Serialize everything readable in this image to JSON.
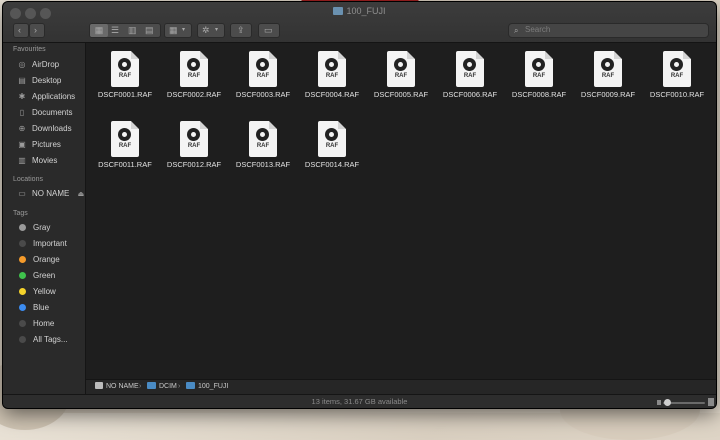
{
  "window": {
    "title": "100_FUJI",
    "search_placeholder": "Search"
  },
  "sidebar": {
    "favourites_header": "Favourites",
    "favourites": [
      {
        "label": "AirDrop",
        "icon": "airdrop-icon"
      },
      {
        "label": "Desktop",
        "icon": "desktop-icon"
      },
      {
        "label": "Applications",
        "icon": "applications-icon"
      },
      {
        "label": "Documents",
        "icon": "documents-icon"
      },
      {
        "label": "Downloads",
        "icon": "downloads-icon"
      },
      {
        "label": "Pictures",
        "icon": "pictures-icon"
      },
      {
        "label": "Movies",
        "icon": "movies-icon"
      }
    ],
    "locations_header": "Locations",
    "locations": [
      {
        "label": "NO NAME",
        "icon": "drive-icon"
      }
    ],
    "tags_header": "Tags",
    "tags": [
      {
        "label": "Gray",
        "color": "#9a9a9a"
      },
      {
        "label": "Important",
        "color": "#4a4a4a"
      },
      {
        "label": "Orange",
        "color": "#f59b2b"
      },
      {
        "label": "Green",
        "color": "#3fc24c"
      },
      {
        "label": "Yellow",
        "color": "#f5d32b"
      },
      {
        "label": "Blue",
        "color": "#3c8cf0"
      },
      {
        "label": "Home",
        "color": "#4a4a4a"
      },
      {
        "label": "All Tags...",
        "color": "#4a4a4a"
      }
    ]
  },
  "files": {
    "ext": "RAF",
    "items": [
      "DSCF0001.RAF",
      "DSCF0002.RAF",
      "DSCF0003.RAF",
      "DSCF0004.RAF",
      "DSCF0005.RAF",
      "DSCF0006.RAF",
      "DSCF0008.RAF",
      "DSCF0009.RAF",
      "DSCF0010.RAF",
      "DSCF0011.RAF",
      "DSCF0012.RAF",
      "DSCF0013.RAF",
      "DSCF0014.RAF"
    ]
  },
  "pathbar": {
    "segments": [
      "NO NAME",
      "DCIM",
      "100_FUJI"
    ]
  },
  "status": {
    "text": "13 items, 31.67 GB available"
  }
}
